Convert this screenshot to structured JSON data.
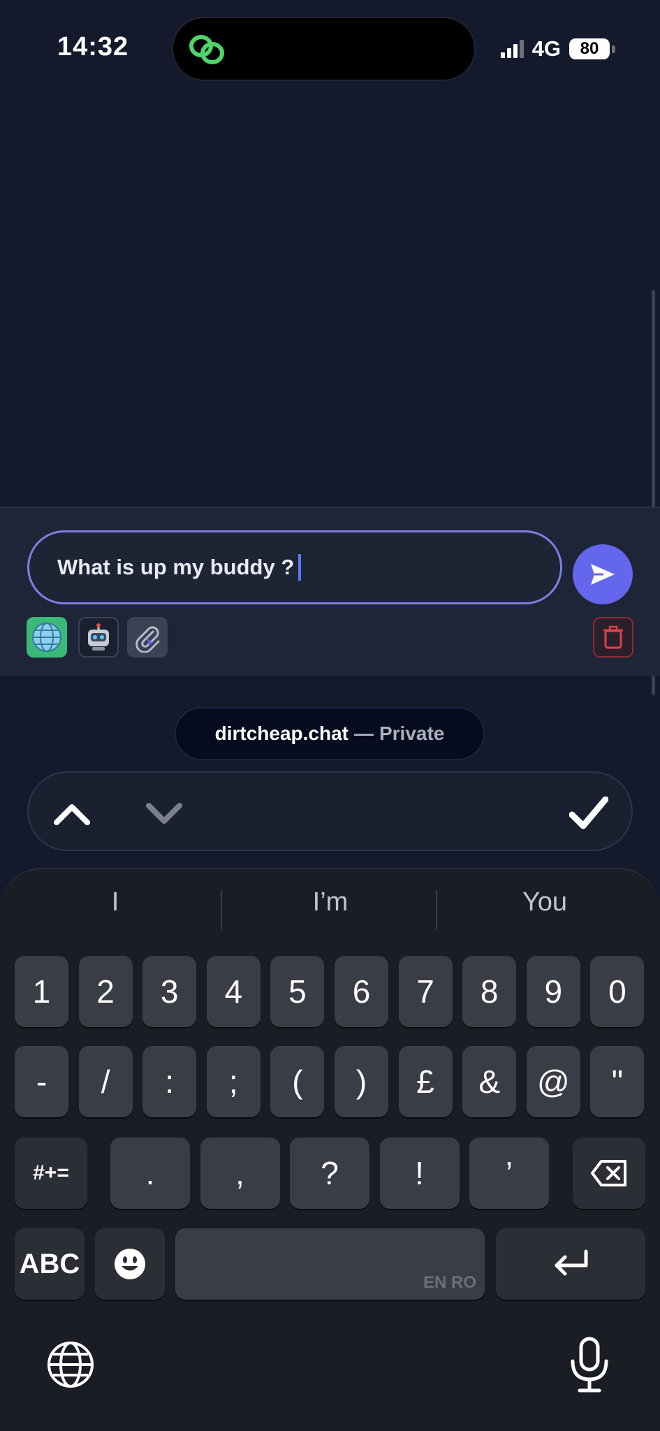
{
  "status_bar": {
    "time": "14:32",
    "network": "4G",
    "battery": "80",
    "island_icon": "link-rings-icon"
  },
  "composer": {
    "input_value": "What is up my buddy ?",
    "send_icon": "send-icon",
    "tools": [
      "globe-icon",
      "robot-icon",
      "paperclip-icon"
    ],
    "trash_icon": "trash-icon"
  },
  "brand": {
    "name": "dirtcheap.chat",
    "separator": "—",
    "mode": "Private"
  },
  "accessory": {
    "up_icon": "chevron-up-icon",
    "down_icon": "chevron-down-icon",
    "done_icon": "checkmark-icon"
  },
  "keyboard": {
    "suggestions": [
      "I",
      "I’m",
      "You"
    ],
    "row1": [
      "1",
      "2",
      "3",
      "4",
      "5",
      "6",
      "7",
      "8",
      "9",
      "0"
    ],
    "row2": [
      "-",
      "/",
      ":",
      ";",
      "(",
      ")",
      "£",
      "&",
      "@",
      "\""
    ],
    "row3_mode": "#+=",
    "row3": [
      ".",
      ",",
      "?",
      "!",
      "’"
    ],
    "abc": "ABC",
    "space_languages": "EN RO",
    "colors": {
      "key": "#3a3d46",
      "special_key": "#2c2e36",
      "accent": "#6466ee"
    }
  }
}
